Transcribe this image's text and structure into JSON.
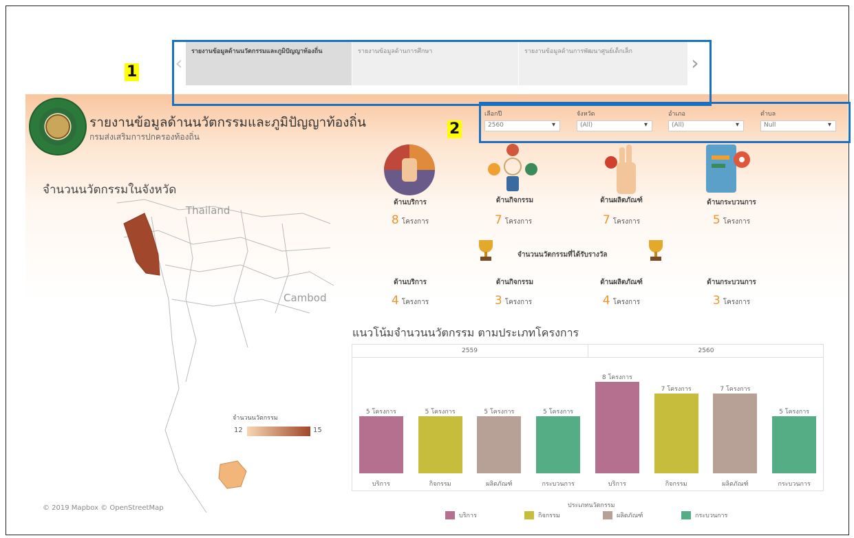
{
  "tabs": [
    {
      "label": "รายงานข้อมูลด้านนวัตกรรมและภูมิปัญญาท้องถิ่น",
      "active": true
    },
    {
      "label": "รายงานข้อมูลด้านการศึกษา",
      "active": false
    },
    {
      "label": "รายงานข้อมูลด้านการพัฒนาศูนย์เด็กเล็ก",
      "active": false
    }
  ],
  "annotations": {
    "tabs_marker": "1",
    "filters_marker": "2"
  },
  "header": {
    "title": "รายงานข้อมูลด้านนวัตกรรมและภูมิปัญญาท้องถิ่น",
    "subtitle": "กรมส่งเสริมการปกครองท้องถิ่น"
  },
  "filters": [
    {
      "label": "เลือกปี",
      "value": "2560"
    },
    {
      "label": "จังหวัด",
      "value": "(All)"
    },
    {
      "label": "อำเภอ",
      "value": "(All)"
    },
    {
      "label": "ตำบล",
      "value": "Null"
    }
  ],
  "map": {
    "title": "จำนวนนวัตกรรมในจังหวัด",
    "label_thailand": "Thailand",
    "label_cambodia": "Cambod",
    "legend_title": "จำนวนนวัตกรรม",
    "legend_min": "12",
    "legend_max": "15",
    "copyright": "© 2019 Mapbox © OpenStreetMap"
  },
  "categories": [
    {
      "label": "ด้านบริการ",
      "count": "8",
      "unit": "โครงการ",
      "award": "4"
    },
    {
      "label": "ด้านกิจกรรม",
      "count": "7",
      "unit": "โครงการ",
      "award": "3"
    },
    {
      "label": "ด้านผลิตภัณฑ์",
      "count": "7",
      "unit": "โครงการ",
      "award": "4"
    },
    {
      "label": "ด้านกระบวนการ",
      "count": "5",
      "unit": "โครงการ",
      "award": "3"
    }
  ],
  "award_title": "จำนวนนวัตกรรมที่ได้รับรางวัล",
  "colors": {
    "service": "#b5708f",
    "activity": "#c7bd3c",
    "product": "#b7a095",
    "process": "#55ad85",
    "accent": "#f0932b",
    "highlight": "#1a6fc0"
  },
  "chart_data": {
    "type": "bar",
    "title": "แนวโน้มจำนวนนวัตกรรม ตามประเภทโครงการ",
    "panels": [
      "2559",
      "2560"
    ],
    "categories": [
      "บริการ",
      "กิจกรรม",
      "ผลิตภัณฑ์",
      "กระบวนการ"
    ],
    "series": [
      {
        "panel": "2559",
        "values": [
          5,
          5,
          5,
          5
        ]
      },
      {
        "panel": "2560",
        "values": [
          8,
          7,
          7,
          5
        ]
      }
    ],
    "value_unit": "โครงการ",
    "ylim": [
      0,
      8
    ],
    "legend_title": "ประเภทนวัตกรรม",
    "legend": [
      "บริการ",
      "กิจกรรม",
      "ผลิตภัณฑ์",
      "กระบวนการ"
    ]
  }
}
